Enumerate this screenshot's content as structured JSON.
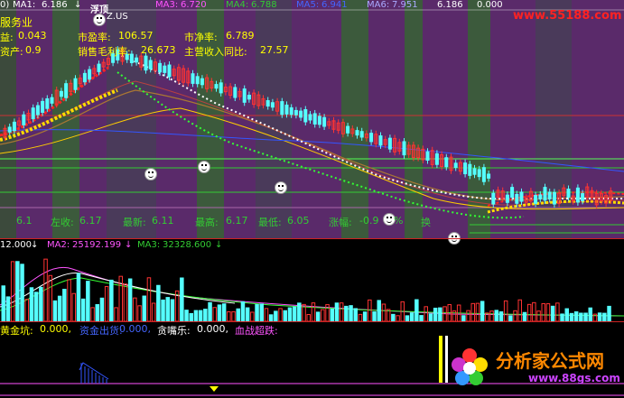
{
  "top_bar": {
    "prefix": "0)",
    "ma1_label": "MA1:",
    "ma1_value": "6.186",
    "ma1_arrow": "↓",
    "fuding_label": "浮顶",
    "ma3_label": "MA3:",
    "ma3_value": "6.720",
    "ma4_label": "MA4:",
    "ma4_value": "6.788",
    "ma5_label": "MA5:",
    "ma5_value": "6.941",
    "ma6_label": "MA6:",
    "ma6_value": "7.951",
    "extra_value": "6.186",
    "extra_zero": "0.000",
    "watermark_url": "www.55188.com"
  },
  "info_panel": {
    "industry": "服务业",
    "eps_label": "益:",
    "eps_value": "0.043",
    "pe_label": "市盈率:",
    "pe_value": "106.57",
    "pb_label": "市净率:",
    "pb_value": "6.789",
    "asset_label": "资产:",
    "asset_value": "0.9",
    "gross_margin_label": "销售毛利率:",
    "gross_margin_value": "26.673",
    "revenue_growth_label": "主营收入同比:",
    "revenue_growth_value": "27.57",
    "overlay_code": "Z.US"
  },
  "price_strip": {
    "item1": "6.1",
    "zuoshou_label": "左收:",
    "zuoshou_value": "6.17",
    "zuixin_label": "最新:",
    "zuixin_value": "6.11",
    "zuigao_label": "最高:",
    "zuigao_value": "6.17",
    "zuidi_label": "最低:",
    "zuidi_value": "6.05",
    "zhangfu_label": "涨幅:",
    "zhangfu_value": "-0.9",
    "zhangfu_unit": "%",
    "huanshou_label": "换"
  },
  "volume_bar": {
    "v1_value": "12.000",
    "v1_arrow": "↓",
    "ma2_label": "MA2:",
    "ma2_value": "25192.199",
    "ma2_arrow": "↓",
    "ma3_label": "MA3:",
    "ma3_value": "32328.600",
    "ma3_arrow": "↓"
  },
  "indicator_bar": {
    "gold_label": "黄金坑:",
    "gold_value": "0.000,",
    "outflow_label": "资金出货:",
    "outflow_value": "0.000,",
    "greedy_label": "贪嘴乐:",
    "greedy_value": "0.000,",
    "blood_label": "血战超跌:"
  },
  "logo": {
    "title": "分析家公式网",
    "url": "www.88gs.com"
  },
  "colors": {
    "background": "#000000",
    "accent_yellow": "#ffff00",
    "up_red": "#ff3333",
    "down_cyan": "#55ffff",
    "band_purple": "#5a2a6a",
    "band_green": "#3a6a3a"
  }
}
